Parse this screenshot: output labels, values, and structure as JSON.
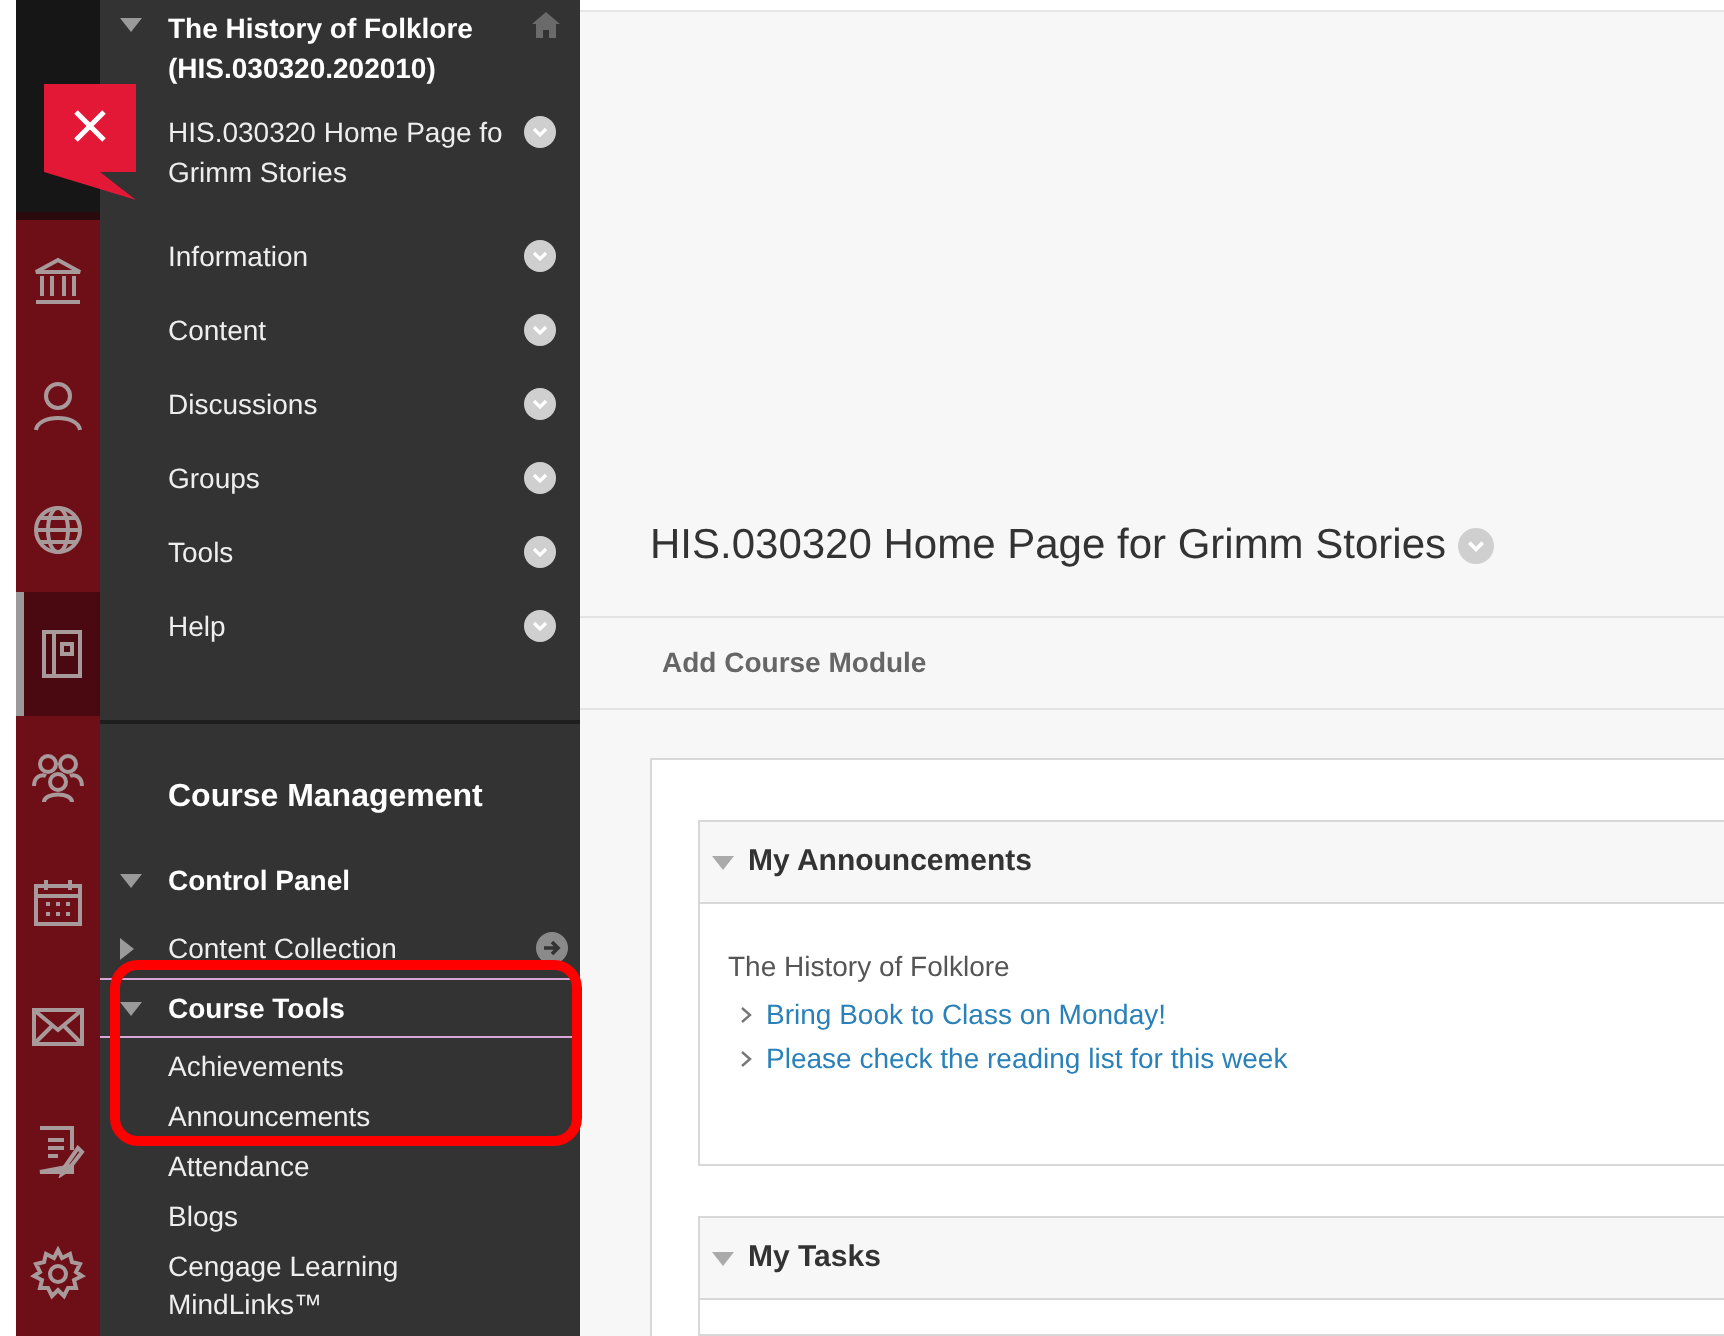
{
  "rail": {
    "items": [
      {
        "kind": "bank",
        "selected": false
      },
      {
        "kind": "person",
        "selected": false
      },
      {
        "kind": "globe",
        "selected": false
      },
      {
        "kind": "notebook",
        "selected": true
      },
      {
        "kind": "people",
        "selected": false
      },
      {
        "kind": "calendar",
        "selected": false
      },
      {
        "kind": "envelope",
        "selected": false
      },
      {
        "kind": "document",
        "selected": false
      },
      {
        "kind": "gear",
        "selected": false
      }
    ]
  },
  "course_menu": {
    "title": "The History of Folklore (HIS.030320.202010)",
    "expanded": true,
    "items": [
      {
        "lines": [
          "HIS.030320 Home Page fo",
          "Grimm Stories"
        ]
      },
      {
        "lines": [
          "Information"
        ]
      },
      {
        "lines": [
          "Content"
        ]
      },
      {
        "lines": [
          "Discussions"
        ]
      },
      {
        "lines": [
          "Groups"
        ]
      },
      {
        "lines": [
          "Tools"
        ]
      },
      {
        "lines": [
          "Help"
        ]
      }
    ]
  },
  "course_management": {
    "heading": "Course Management",
    "control_panel": {
      "label": "Control Panel",
      "expanded": true
    },
    "sections": [
      {
        "label": "Content Collection",
        "expanded": false,
        "selected": false,
        "highlighted": false
      },
      {
        "label": "Course Tools",
        "expanded": true,
        "selected": true,
        "highlighted": true,
        "children": [
          "Achievements",
          "Announcements",
          "Attendance",
          "Blogs",
          "Cengage Learning MindLinks™"
        ]
      }
    ]
  },
  "page": {
    "title": "HIS.030320 Home Page for Grimm Stories",
    "toolbar": [
      "Add Course Module"
    ],
    "modules": [
      {
        "title": "My Announcements",
        "expanded": true,
        "course": "The History of Folklore",
        "links": [
          "Bring Book to Class on Monday!",
          "Please check the reading list for this week"
        ]
      },
      {
        "title": "My Tasks",
        "expanded": true
      }
    ]
  }
}
